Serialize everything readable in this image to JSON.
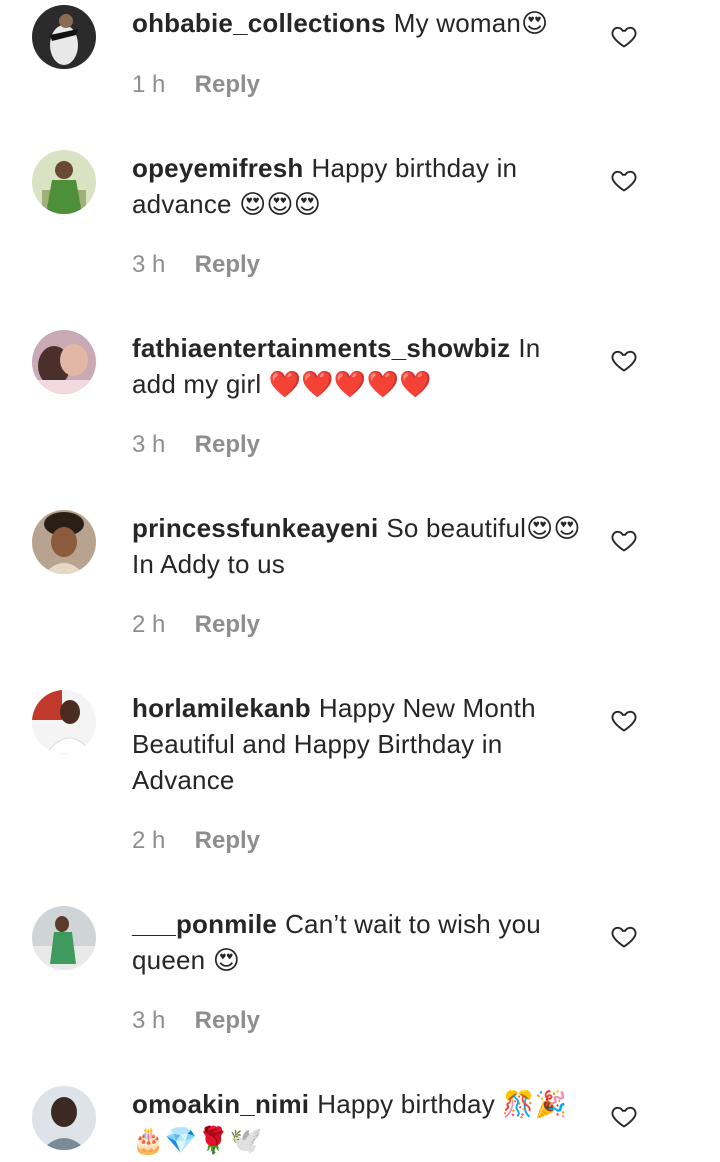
{
  "comments": [
    {
      "username": "ohbabie_collections",
      "text": "My woman😍",
      "time": "1 h",
      "reply": "Reply"
    },
    {
      "username": "opeyemifresh",
      "text": "Happy birthday in advance 😍😍😍",
      "time": "3 h",
      "reply": "Reply"
    },
    {
      "username": "fathiaentertainments_showbiz",
      "text": "In add my girl ❤️❤️❤️❤️❤️",
      "time": "3 h",
      "reply": "Reply"
    },
    {
      "username": "princessfunkeayeni",
      "text": "So beautiful😍😍 In Addy to us",
      "time": "2 h",
      "reply": "Reply"
    },
    {
      "username": "horlamilekanb",
      "text": "Happy New Month Beautiful and Happy Birthday in Advance",
      "time": "2 h",
      "reply": "Reply"
    },
    {
      "username": "___ponmile",
      "text": "Can’t wait to wish you queen 😍",
      "time": "3 h",
      "reply": "Reply"
    },
    {
      "username": "omoakin_nimi",
      "text": "Happy birthday 🎊🎉🎂💎🌹🕊️",
      "time": "",
      "reply": ""
    }
  ]
}
